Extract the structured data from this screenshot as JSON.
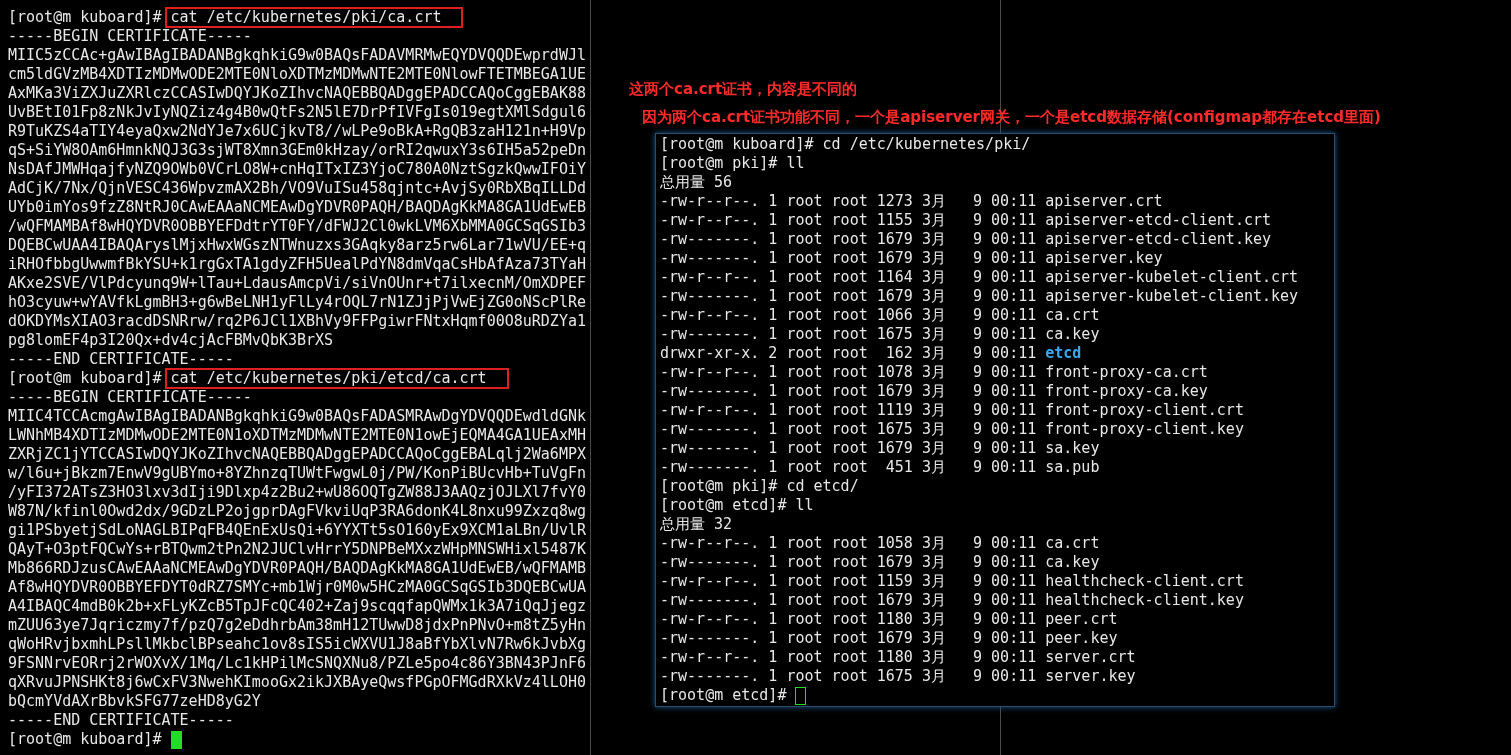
{
  "left_terminal": {
    "focused": true,
    "lines": [
      {
        "kind": "prompt",
        "prompt": "[root@m kuboard]#",
        "command": "cat /etc/kubernetes/pki/ca.crt",
        "highlighted": true
      },
      {
        "kind": "text",
        "text": "-----BEGIN CERTIFICATE-----"
      },
      {
        "kind": "text",
        "text": "MIIC5zCCAc+gAwIBAgIBADANBgkqhkiG9w0BAQsFADAVMRMwEQYDVQQDEwprdWJl"
      },
      {
        "kind": "text",
        "text": "cm5ldGVzMB4XDTIzMDMwODE2MTE0NloXDTMzMDMwNTE2MTE0NlowFTETMBEGA1UE"
      },
      {
        "kind": "text",
        "text": "AxMKa3ViZXJuZXRlczCCASIwDQYJKoZIhvcNAQEBBQADggEPADCCAQoCggEBAK88"
      },
      {
        "kind": "text",
        "text": "UvBEtI01Fp8zNkJvIyNQZiz4g4B0wQtFs2N5lE7DrPfIVFgIs019egtXMlSdgul6"
      },
      {
        "kind": "text",
        "text": "R9TuKZS4aTIY4eyaQxw2NdYJe7x6UCjkvT8//wLPe9oBkA+RgQB3zaH121n+H9Vp"
      },
      {
        "kind": "text",
        "text": "qS+SiYW8OAm6HmnkNQJ3G3sjWT8Xmn3GEm0kHzay/orRI2qwuxY3s6IH5a52peDn"
      },
      {
        "kind": "text",
        "text": "NsDAfJMWHqajfyNZQ9OWb0VCrLO8W+cnHqITxIZ3YjoC780A0NztSgzkQwwIFOiY"
      },
      {
        "kind": "text",
        "text": "AdCjK/7Nx/QjnVESC436WpvzmAX2Bh/VO9VuISu458qjntc+AvjSy0RbXBqILLDd"
      },
      {
        "kind": "text",
        "text": "UYb0imYos9fzZ8NtRJ0CAwEAAaNCMEAwDgYDVR0PAQH/BAQDAgKkMA8GA1UdEwEB"
      },
      {
        "kind": "text",
        "text": "/wQFMAMBAf8wHQYDVR0OBBYEFDdtrYT0FY/dFWJ2Cl0wkLVM6XbMMA0GCSqGSIb3"
      },
      {
        "kind": "text",
        "text": "DQEBCwUAA4IBAQAryslMjxHwxWGszNTWnuzxs3GAqky8arz5rw6Lar71wVU/EE+q"
      },
      {
        "kind": "text",
        "text": "iRHOfbbgUwwmfBkYSU+k1rgGxTA1gdyZFH5UealPdYN8dmVqaCsHbAfAza73TYaH"
      },
      {
        "kind": "text",
        "text": "AKxe2SVE/VlPdcyunq9W+lTau+LdausAmcpVi/siVnOUnr+t7ilxecnM/OmXDPEF"
      },
      {
        "kind": "text",
        "text": "hO3cyuw+wYAVfkLgmBH3+g6wBeLNH1yFlLy4rOQL7rN1ZJjPjVwEjZG0oNScPlRe"
      },
      {
        "kind": "text",
        "text": "dOKDYMsXIAO3racdDSNRrw/rq2P6JCl1XBhVy9FFPgiwrFNtxHqmf00O8uRDZYa1"
      },
      {
        "kind": "text",
        "text": "pg8lomEF4p3I20Qx+dv4cjAcFBMvQbK3BrXS"
      },
      {
        "kind": "text",
        "text": "-----END CERTIFICATE-----"
      },
      {
        "kind": "prompt",
        "prompt": "[root@m kuboard]#",
        "command": "cat /etc/kubernetes/pki/etcd/ca.crt",
        "highlighted": true
      },
      {
        "kind": "text",
        "text": "-----BEGIN CERTIFICATE-----"
      },
      {
        "kind": "text",
        "text": "MIIC4TCCAcmgAwIBAgIBADANBgkqhkiG9w0BAQsFADASMRAwDgYDVQQDEwdldGNk"
      },
      {
        "kind": "text",
        "text": "LWNhMB4XDTIzMDMwODE2MTE0N1oXDTMzMDMwNTE2MTE0N1owEjEQMA4GA1UEAxMH"
      },
      {
        "kind": "text",
        "text": "ZXRjZC1jYTCCASIwDQYJKoZIhvcNAQEBBQADggEPADCCAQoCggEBALqlj2Wa6MPX"
      },
      {
        "kind": "text",
        "text": "w/l6u+jBkzm7EnwV9gUBYmo+8YZhnzqTUWtFwgwL0j/PW/KonPiBUcvHb+TuVgFn"
      },
      {
        "kind": "text",
        "text": "/yFI372ATsZ3HO3lxv3dIji9Dlxp4z2Bu2+wU86OQTgZW88J3AAQzjOJLXl7fvY0"
      },
      {
        "kind": "text",
        "text": "W87N/kfinl0Owd2dx/9GDzLP2ojgprDAgFVkviUqP3RA6donK4L8nxu99Zxzq8wg"
      },
      {
        "kind": "text",
        "text": "gi1PSbyetjSdLoNAGLBIPqFB4QEnExUsQi+6YYXTt5sO160yEx9XCM1aLBn/UvlR"
      },
      {
        "kind": "text",
        "text": "QAyT+O3ptFQCwYs+rBTQwm2tPn2N2JUClvHrrY5DNPBeMXxzWHpMNSWHixl5487K"
      },
      {
        "kind": "text",
        "text": "Mb866RDJzusCAwEAAaNCMEAwDgYDVR0PAQH/BAQDAgKkMA8GA1UdEwEB/wQFMAMB"
      },
      {
        "kind": "text",
        "text": "Af8wHQYDVR0OBBYEFDYT0dRZ7SMYc+mb1Wjr0M0w5HCzMA0GCSqGSIb3DQEBCwUA"
      },
      {
        "kind": "text",
        "text": "A4IBAQC4mdB0k2b+xFLyKZcB5TpJFcQC402+Zaj9scqqfapQWMx1k3A7iQqJjegz"
      },
      {
        "kind": "text",
        "text": "mZUU63ye7Jqriczmy7f/pzQ7g2eDdhrbAm38mH12TUwwD8jdxPnPNvO+m8tZ5yHn"
      },
      {
        "kind": "text",
        "text": "qWoHRvjbxmhLPsllMkbclBPseahc1ov8sIS5icWXVU1J8aBfYbXlvN7Rw6kJvbXg"
      },
      {
        "kind": "text",
        "text": "9FSNNrvEORrj2rWOXvX/1Mq/Lc1kHPilMcSNQXNu8/PZLe5po4c86Y3BN43PJnF6"
      },
      {
        "kind": "text",
        "text": "qXRvuJPNSHKt8j6wCxFV3NwehKImooGx2ikJXBAyeQwsfPGpOFMGdRXkVz4lLOH0"
      },
      {
        "kind": "text",
        "text": "bQcmYVdAXrBbvkSFG77zeHD8yG2Y"
      },
      {
        "kind": "text",
        "text": "-----END CERTIFICATE-----"
      },
      {
        "kind": "prompt",
        "prompt": "[root@m kuboard]#",
        "cursor": true
      }
    ]
  },
  "annotations": [
    {
      "text": "这两个ca.crt证书，内容是不同的"
    },
    {
      "text": "因为两个ca.crt证书功能不同，一个是apiserver网关，一个是etcd数据存储(configmap都存在etcd里面)"
    }
  ],
  "right_terminal": {
    "focused": false,
    "lines": [
      {
        "kind": "prompt",
        "prompt": "[root@m kuboard]#",
        "command": "cd /etc/kubernetes/pki/",
        "highlighted": false
      },
      {
        "kind": "prompt",
        "prompt": "[root@m pki]#",
        "command": "ll",
        "highlighted": false
      },
      {
        "kind": "text",
        "text": "总用量 56"
      },
      {
        "kind": "entry",
        "details": "-rw-r--r--. 1 root root 1273 3月   9 00:11",
        "name": "apiserver.crt",
        "directory": false
      },
      {
        "kind": "entry",
        "details": "-rw-r--r--. 1 root root 1155 3月   9 00:11",
        "name": "apiserver-etcd-client.crt",
        "directory": false
      },
      {
        "kind": "entry",
        "details": "-rw-------. 1 root root 1679 3月   9 00:11",
        "name": "apiserver-etcd-client.key",
        "directory": false
      },
      {
        "kind": "entry",
        "details": "-rw-------. 1 root root 1679 3月   9 00:11",
        "name": "apiserver.key",
        "directory": false
      },
      {
        "kind": "entry",
        "details": "-rw-r--r--. 1 root root 1164 3月   9 00:11",
        "name": "apiserver-kubelet-client.crt",
        "directory": false
      },
      {
        "kind": "entry",
        "details": "-rw-------. 1 root root 1679 3月   9 00:11",
        "name": "apiserver-kubelet-client.key",
        "directory": false
      },
      {
        "kind": "entry",
        "details": "-rw-r--r--. 1 root root 1066 3月   9 00:11",
        "name": "ca.crt",
        "directory": false
      },
      {
        "kind": "entry",
        "details": "-rw-------. 1 root root 1675 3月   9 00:11",
        "name": "ca.key",
        "directory": false
      },
      {
        "kind": "entry",
        "details": "drwxr-xr-x. 2 root root  162 3月   9 00:11",
        "name": "etcd",
        "directory": true
      },
      {
        "kind": "entry",
        "details": "-rw-r--r--. 1 root root 1078 3月   9 00:11",
        "name": "front-proxy-ca.crt",
        "directory": false
      },
      {
        "kind": "entry",
        "details": "-rw-------. 1 root root 1679 3月   9 00:11",
        "name": "front-proxy-ca.key",
        "directory": false
      },
      {
        "kind": "entry",
        "details": "-rw-r--r--. 1 root root 1119 3月   9 00:11",
        "name": "front-proxy-client.crt",
        "directory": false
      },
      {
        "kind": "entry",
        "details": "-rw-------. 1 root root 1675 3月   9 00:11",
        "name": "front-proxy-client.key",
        "directory": false
      },
      {
        "kind": "entry",
        "details": "-rw-------. 1 root root 1679 3月   9 00:11",
        "name": "sa.key",
        "directory": false
      },
      {
        "kind": "entry",
        "details": "-rw-------. 1 root root  451 3月   9 00:11",
        "name": "sa.pub",
        "directory": false
      },
      {
        "kind": "prompt",
        "prompt": "[root@m pki]#",
        "command": "cd etcd/",
        "highlighted": false
      },
      {
        "kind": "prompt",
        "prompt": "[root@m etcd]#",
        "command": "ll",
        "highlighted": false
      },
      {
        "kind": "text",
        "text": "总用量 32"
      },
      {
        "kind": "entry",
        "details": "-rw-r--r--. 1 root root 1058 3月   9 00:11",
        "name": "ca.crt",
        "directory": false
      },
      {
        "kind": "entry",
        "details": "-rw-------. 1 root root 1679 3月   9 00:11",
        "name": "ca.key",
        "directory": false
      },
      {
        "kind": "entry",
        "details": "-rw-r--r--. 1 root root 1159 3月   9 00:11",
        "name": "healthcheck-client.crt",
        "directory": false
      },
      {
        "kind": "entry",
        "details": "-rw-------. 1 root root 1679 3月   9 00:11",
        "name": "healthcheck-client.key",
        "directory": false
      },
      {
        "kind": "entry",
        "details": "-rw-r--r--. 1 root root 1180 3月   9 00:11",
        "name": "peer.crt",
        "directory": false
      },
      {
        "kind": "entry",
        "details": "-rw-------. 1 root root 1679 3月   9 00:11",
        "name": "peer.key",
        "directory": false
      },
      {
        "kind": "entry",
        "details": "-rw-r--r--. 1 root root 1180 3月   9 00:11",
        "name": "server.crt",
        "directory": false
      },
      {
        "kind": "entry",
        "details": "-rw-------. 1 root root 1675 3月   9 00:11",
        "name": "server.key",
        "directory": false
      },
      {
        "kind": "prompt",
        "prompt": "[root@m etcd]#",
        "cursor": true
      }
    ]
  }
}
